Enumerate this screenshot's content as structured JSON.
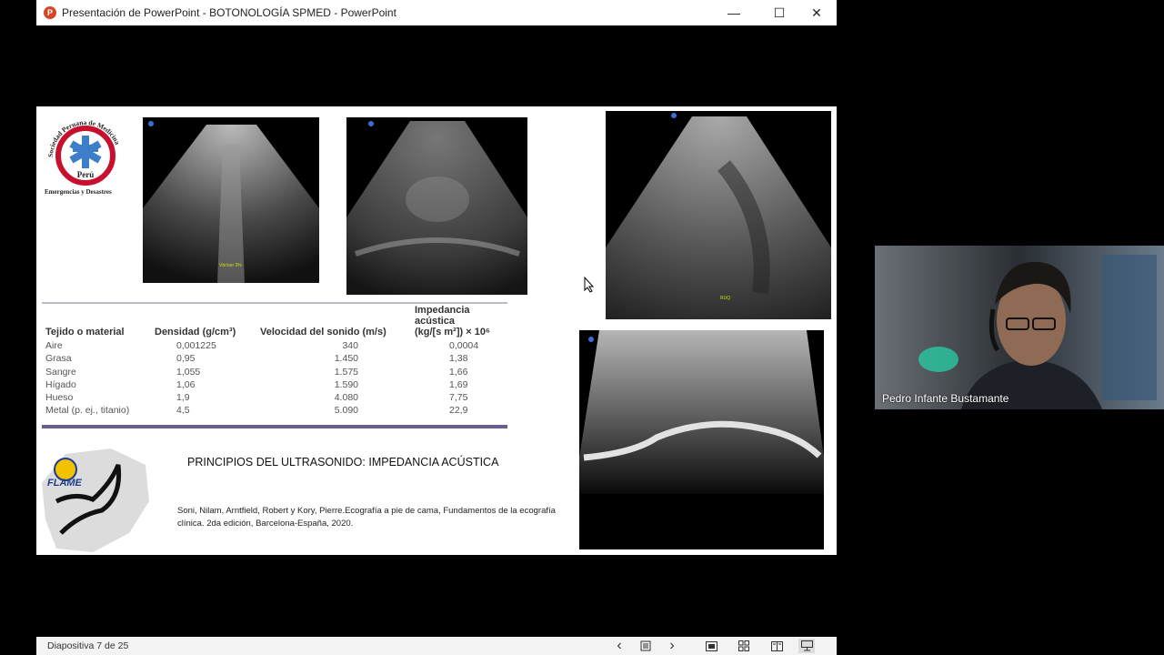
{
  "window": {
    "title": "Presentación de PowerPoint  -  BOTONOLOGÍA SPMED  -  PowerPoint",
    "minimize_glyph": "—",
    "maximize_glyph": "☐",
    "close_glyph": "✕",
    "app_icon_letter": "P"
  },
  "slide": {
    "logo_spmed": {
      "ring_text": "Sociedad Peruana de Medicina",
      "center_text": "Perú",
      "bottom_text": "Emergencias y Desastres"
    },
    "logo_flame": {
      "text": "FLAME"
    },
    "ultrasound_labels": [
      "Vbr/ser 3%",
      "RUQ"
    ],
    "table": {
      "headers": [
        "Tejido o material",
        "Densidad (g/cm³)",
        "Velocidad del sonido (m/s)",
        "Impedancia acústica",
        "(kg/[s m²]) × 10⁶"
      ],
      "rows": [
        [
          "Aire",
          "0,001225",
          "340",
          "0,0004"
        ],
        [
          "Grasa",
          "0,95",
          "1.450",
          "1,38"
        ],
        [
          "Sangre",
          "1,055",
          "1.575",
          "1,66"
        ],
        [
          "Hígado",
          "1,06",
          "1.590",
          "1,69"
        ],
        [
          "Hueso",
          "1,9",
          "4.080",
          "7,75"
        ],
        [
          "Metal (p. ej., titanio)",
          "4,5",
          "5.090",
          "22,9"
        ]
      ]
    },
    "caption_title": "PRINCIPIOS DEL ULTRASONIDO: IMPEDANCIA ACÚSTICA",
    "caption_ref": "Soni, Nilam, Arntfield, Robert y Kory, Pierre.Ecografía a pie de cama, Fundamentos de la ecografía clínica. 2da edición, Barcelona-España, 2020."
  },
  "statusbar": {
    "slide_counter": "Diapositiva 7 de 25",
    "prev_glyph": "‹",
    "next_glyph": "›"
  },
  "participant": {
    "name": "Pedro Infante Bustamante"
  },
  "colors": {
    "slide_bg": "#ffffff",
    "table_accent": "#6b5b95",
    "app_accent": "#d24726"
  }
}
